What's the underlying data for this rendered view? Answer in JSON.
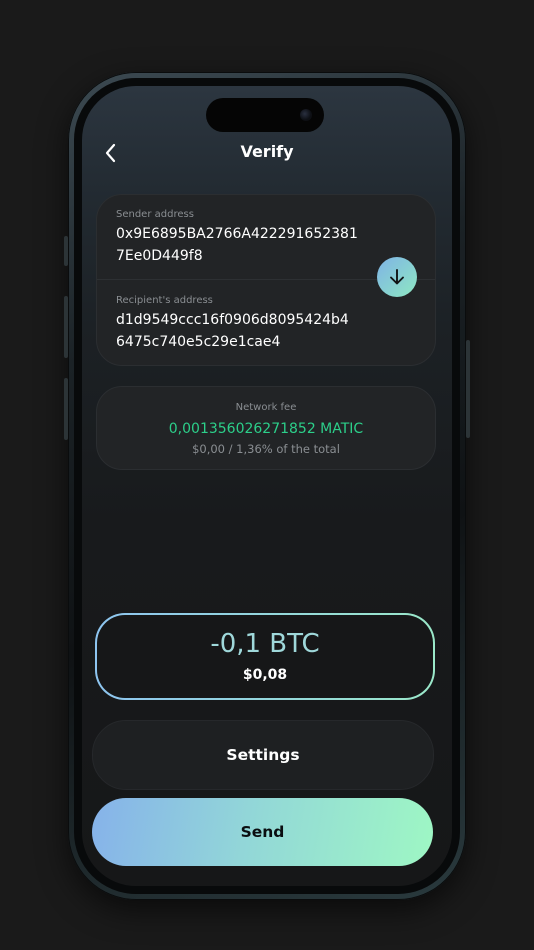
{
  "header": {
    "title": "Verify",
    "back_icon": "chevron-left-icon"
  },
  "addresses": {
    "sender_label": "Sender address",
    "sender_line1": "0x9E6895BA2766A422291652381",
    "sender_line2": "7Ee0D449f8",
    "recipient_label": "Recipient's address",
    "recipient_line1": "d1d9549ccc16f0906d8095424b4",
    "recipient_line2": "6475c740e5c29e1cae4",
    "swap_icon": "arrow-down-icon"
  },
  "fee": {
    "label": "Network fee",
    "amount": "0,001356026271852 MATIC",
    "subtext": "$0,00 / 1,36% of the total"
  },
  "amount": {
    "crypto": "-0,1 BTC",
    "fiat": "$0,08"
  },
  "actions": {
    "settings_label": "Settings",
    "send_label": "Send"
  },
  "colors": {
    "fee_green": "#2ccf8a",
    "gradient_start": "#86b2ea",
    "gradient_end": "#9ef7c4",
    "background": "#1a1a1a"
  }
}
